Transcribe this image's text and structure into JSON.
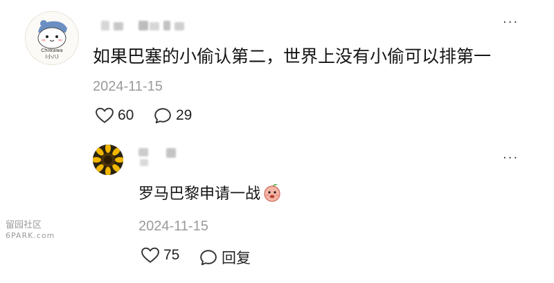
{
  "comment": {
    "avatar_label": "Chiikawa",
    "avatar_caption": "(小八)",
    "text": "如果巴塞的小偷认第二，世界上没有小偷可以排第一",
    "date": "2024-11-15",
    "likes": "60",
    "replies": "29",
    "more": "···"
  },
  "reply": {
    "text": "罗马巴黎申请一战",
    "date": "2024-11-15",
    "likes": "75",
    "reply_label": "回复",
    "more": "···"
  },
  "watermark": {
    "line1": "留园社区",
    "line2": "6PARK.com"
  },
  "icon_names": [
    "heart-icon",
    "comment-icon",
    "more-icon",
    "peach-emoji-icon"
  ],
  "colors": {
    "text": "#151515",
    "muted": "#9a9a9a",
    "background": "#ffffff"
  }
}
